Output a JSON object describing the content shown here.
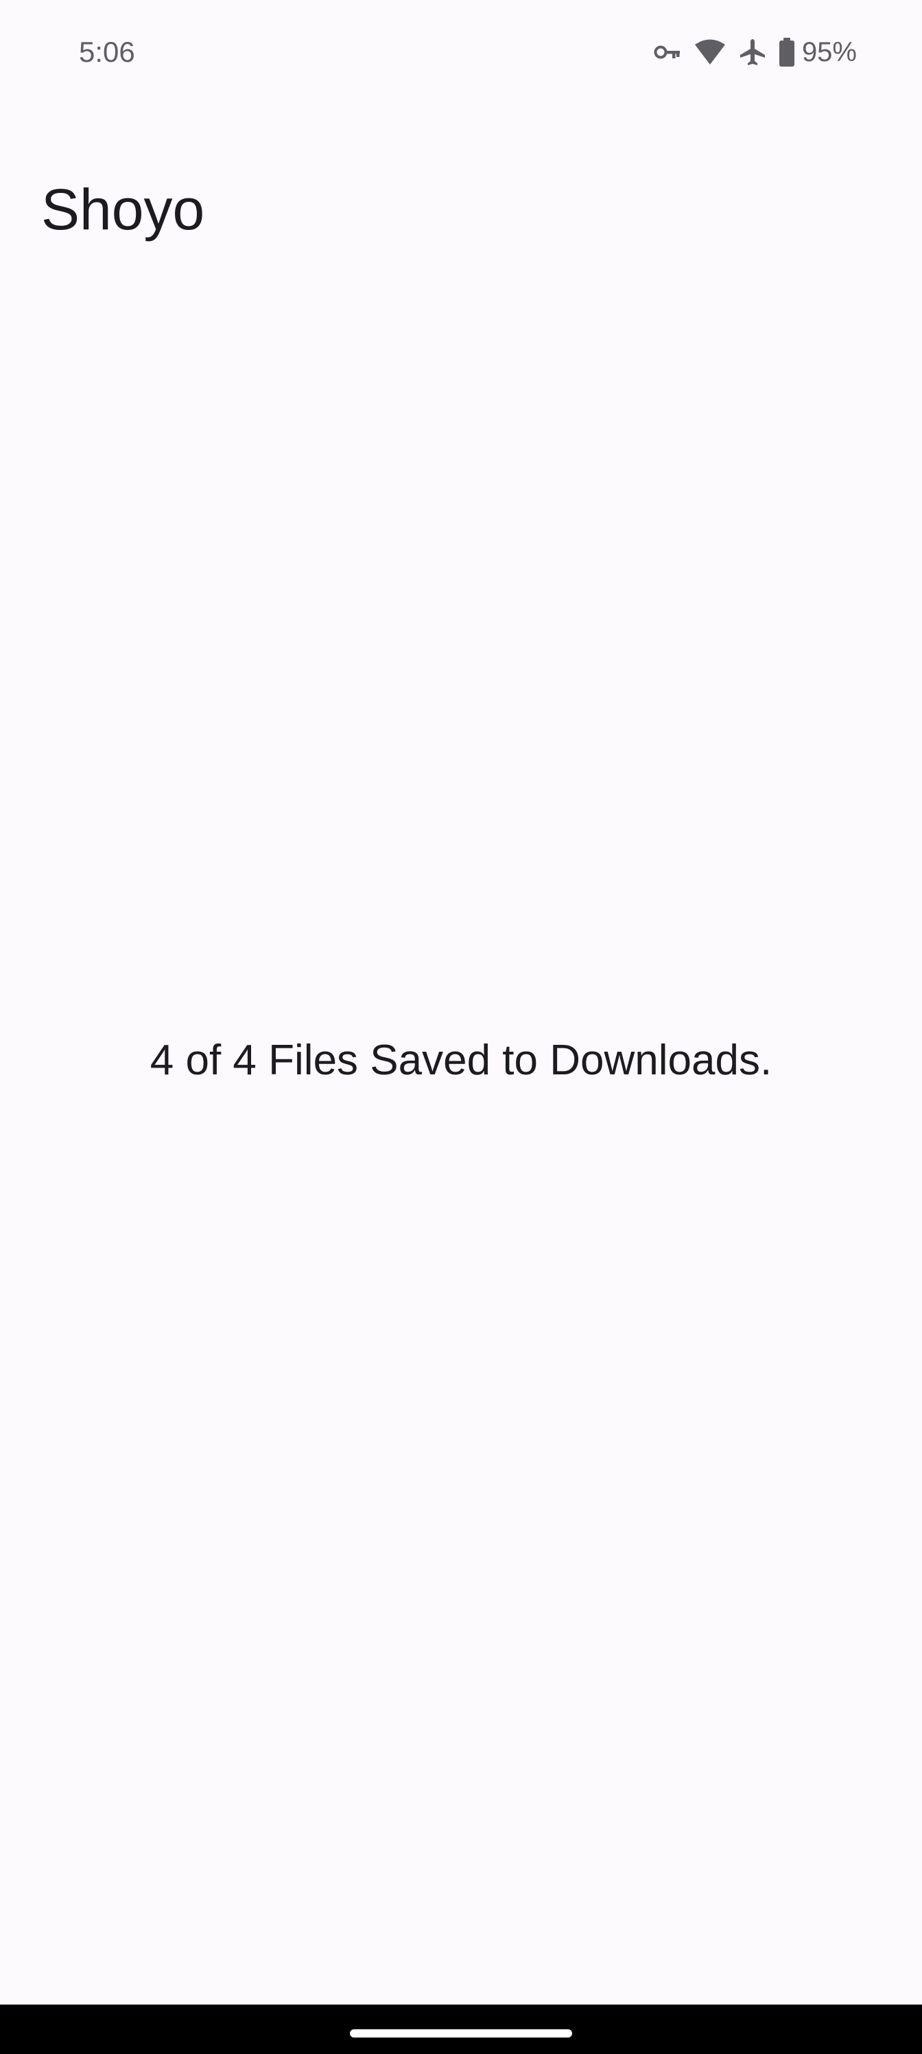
{
  "status_bar": {
    "time": "5:06",
    "battery_percent": "95%",
    "icons": [
      "vpn-key-icon",
      "wifi-icon",
      "airplane-mode-icon",
      "battery-icon"
    ]
  },
  "app": {
    "title": "Shoyo"
  },
  "main": {
    "message": "4 of 4 Files Saved to Downloads."
  },
  "colors": {
    "background": "#FCFAFD",
    "text": "#1C1B1F",
    "status_text": "#5F5E62",
    "nav_bar": "#000000",
    "home_handle": "#FFFFFF"
  }
}
